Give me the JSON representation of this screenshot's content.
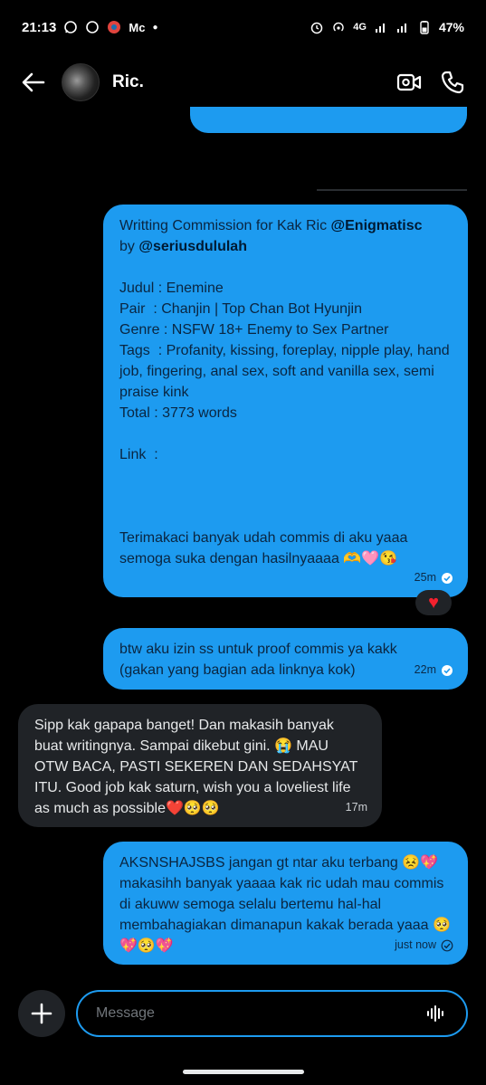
{
  "status_bar": {
    "time": "21:13",
    "network": "4G",
    "battery": "47%",
    "notif_text": "Mc"
  },
  "header": {
    "contact_name": "Ric."
  },
  "messages": [
    {
      "type": "sent",
      "line1_prefix": "Writting Commission for Kak Ric ",
      "line1_mention": "@Enigmatisc",
      "line2_prefix": "by ",
      "line2_mention": "@seriusdululah",
      "body": "Judul : Enemine\nPair  : Chanjin | Top Chan Bot Hyunjin\nGenre : NSFW 18+ Enemy to Sex Partner\nTags  : Profanity, kissing, foreplay, nipple play, hand job, fingering, anal sex, soft and vanilla sex, semi praise kink\nTotal : 3773 words\n\nLink  :\n\n \n\nTerimakaci banyak udah commis di aku yaaa semoga suka dengan hasilnyaaaa 🫶🩷😘",
      "time": "25m",
      "reaction": "♥"
    },
    {
      "type": "sent",
      "body": "btw aku izin ss untuk proof commis ya kakk\n(gakan yang bagian ada linknya kok)",
      "time": "22m"
    },
    {
      "type": "received",
      "body": "Sipp kak gapapa banget! Dan makasih banyak buat writingnya. Sampai dikebut gini. 😭 MAU OTW BACA, PASTI SEKEREN DAN SEDAHSYAT ITU. Good job kak saturn, wish you a loveliest life as much as possible❤️🥺🥺",
      "time": "17m"
    },
    {
      "type": "sent",
      "body": "AKSNSHAJSBS jangan gt ntar aku terbang 😣💖\nmakasihh banyak yaaaa kak ric udah mau commis di akuww semoga selalu bertemu hal-hal membahagiakan dimanapun kakak berada yaaa 🥺💖🥺💖",
      "time": "just now"
    }
  ],
  "composer": {
    "placeholder": "Message"
  },
  "colors": {
    "accent": "#1d9bf0",
    "received_bubble": "#202327",
    "background": "#000000"
  },
  "icons": [
    "back-arrow-icon",
    "video-call-icon",
    "phone-icon",
    "plus-icon",
    "voice-wave-icon",
    "check-icon",
    "heart-icon"
  ]
}
